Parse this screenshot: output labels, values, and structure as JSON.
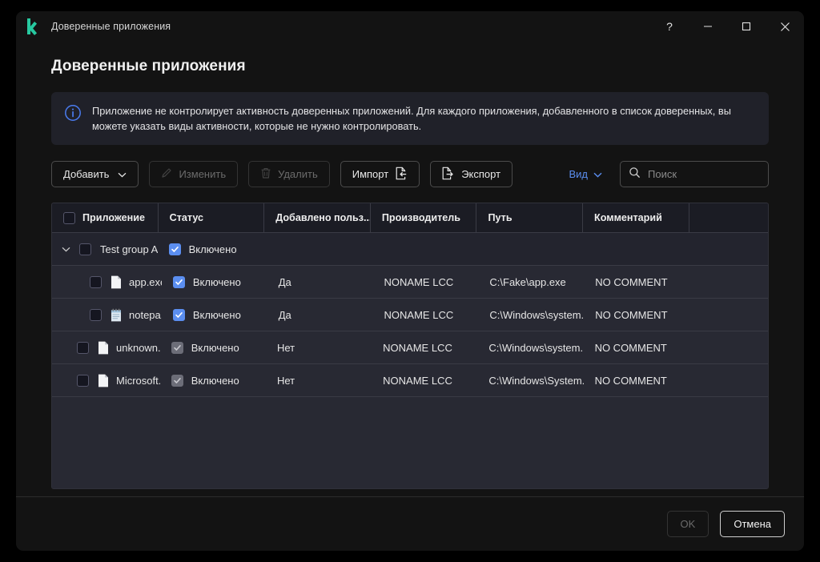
{
  "window": {
    "title": "Доверенные приложения",
    "logo_icon": "kaspersky-k-logo",
    "controls": [
      {
        "name": "help-button",
        "icon": "question-mark-icon",
        "label": "?"
      },
      {
        "name": "minimize-button",
        "icon": "minimize-icon",
        "label": "—"
      },
      {
        "name": "maximize-button",
        "icon": "maximize-icon",
        "label": "□"
      },
      {
        "name": "close-button",
        "icon": "close-icon",
        "label": "✕"
      }
    ]
  },
  "page": {
    "heading": "Доверенные приложения"
  },
  "banner": {
    "icon": "info-circle-icon",
    "text": "Приложение не контролирует активность доверенных приложений. Для каждого приложения, добавленного в список доверенных, вы можете указать виды активности, которые не нужно контролировать.",
    "accent_color": "#4a7cf0",
    "background_color": "#202129"
  },
  "toolbar": {
    "add_label": "Добавить",
    "add_icon": "chevron-down-icon",
    "edit_label": "Изменить",
    "edit_icon": "pencil-icon",
    "delete_label": "Удалить",
    "delete_icon": "trash-icon",
    "import_label": "Импорт",
    "import_icon": "import-document-icon",
    "export_label": "Экспорт",
    "export_icon": "export-document-icon",
    "view_label": "Вид",
    "view_icon": "chevron-down-icon",
    "view_color": "#5b8ef0",
    "search_placeholder": "Поиск",
    "search_value": "",
    "search_icon": "search-icon"
  },
  "table": {
    "headers": [
      "Приложение",
      "Статус",
      "Добавлено польз...",
      "Производитель",
      "Путь",
      "Комментарий",
      ""
    ],
    "header_checkbox": "unchecked",
    "rows": [
      {
        "kind": "group",
        "expander": "chevron-down-icon",
        "checkbox": "unchecked",
        "name": "Test group App",
        "status_checkbox": "checked",
        "status": "Включено",
        "added_by_user": "",
        "vendor": "",
        "path": "",
        "comment": ""
      },
      {
        "kind": "child",
        "icon": "file-document-icon",
        "checkbox": "unchecked",
        "name": "app.exe",
        "status_checkbox": "checked",
        "status": "Включено",
        "added_by_user": "Да",
        "vendor": "NONAME LCC",
        "path": "C:\\Fake\\app.exe",
        "comment": "NO COMMENT"
      },
      {
        "kind": "child",
        "icon": "notepad-icon",
        "checkbox": "unchecked",
        "name": "notepa...",
        "status_checkbox": "checked",
        "status": "Включено",
        "added_by_user": "Да",
        "vendor": "NONAME LCC",
        "path": "C:\\Windows\\system...",
        "comment": "NO COMMENT"
      },
      {
        "kind": "top",
        "icon": "file-document-icon",
        "checkbox": "unchecked",
        "name": "unknown....",
        "status_checkbox": "checked-disabled",
        "status": "Включено",
        "added_by_user": "Нет",
        "vendor": "NONAME LCC",
        "path": "C:\\Windows\\system...",
        "comment": "NO COMMENT"
      },
      {
        "kind": "top",
        "icon": "file-document-icon",
        "checkbox": "unchecked",
        "name": "Microsoft...",
        "status_checkbox": "checked-disabled",
        "status": "Включено",
        "added_by_user": "Нет",
        "vendor": "NONAME LCC",
        "path": "C:\\Windows\\System...",
        "comment": "NO COMMENT"
      }
    ]
  },
  "footer": {
    "ok_label": "OK",
    "cancel_label": "Отмена"
  }
}
